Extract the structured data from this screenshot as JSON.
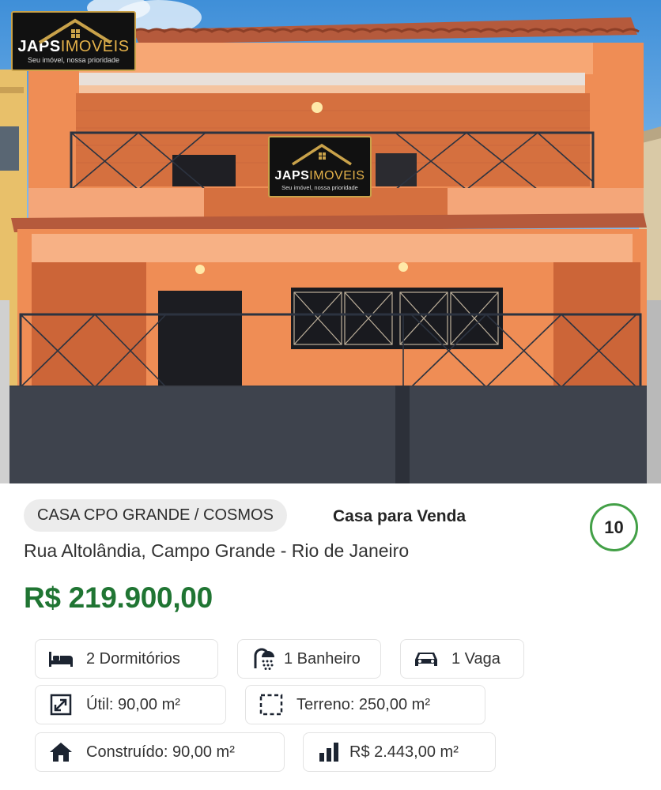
{
  "photo": {
    "watermark_brand": "JAPSIMOVEIS",
    "watermark_brand_main": "JAPS",
    "watermark_brand_accent": "IMOVEIS",
    "watermark_tagline": "Seu imóvel, nossa prioridade",
    "sign_brand_main": "JAPS",
    "sign_brand_accent": "IMOVEIS",
    "sign_tagline": "Seu imóvel, nossa prioridade"
  },
  "listing": {
    "category": "CASA CPO GRANDE / COSMOS",
    "type": "Casa para Venda",
    "photo_count": "10",
    "address": "Rua Altolândia, Campo Grande - Rio de Janeiro",
    "price": "R$ 219.900,00"
  },
  "features": {
    "bedrooms": {
      "label": "2 Dormitórios",
      "icon": "bed-icon"
    },
    "bathrooms": {
      "label": "1 Banheiro",
      "icon": "shower-icon"
    },
    "parking": {
      "label": "1 Vaga",
      "icon": "car-icon"
    },
    "useful_area": {
      "label": "Útil: 90,00 m²",
      "icon": "resize-arrow-icon"
    },
    "land_area": {
      "label": "Terreno: 250,00 m²",
      "icon": "dashed-square-icon"
    },
    "built_area": {
      "label": "Construído: 90,00 m²",
      "icon": "house-icon"
    },
    "price_per_m2": {
      "label": "R$ 2.443,00 m²",
      "icon": "bar-chart-icon"
    }
  },
  "colors": {
    "price_green": "#207533",
    "circle_green": "#43a047",
    "house_orange": "#ef8d55",
    "gate_gray": "#3b3f48",
    "icon_navy": "#1c2431",
    "logo_gold": "#c9a24a"
  }
}
